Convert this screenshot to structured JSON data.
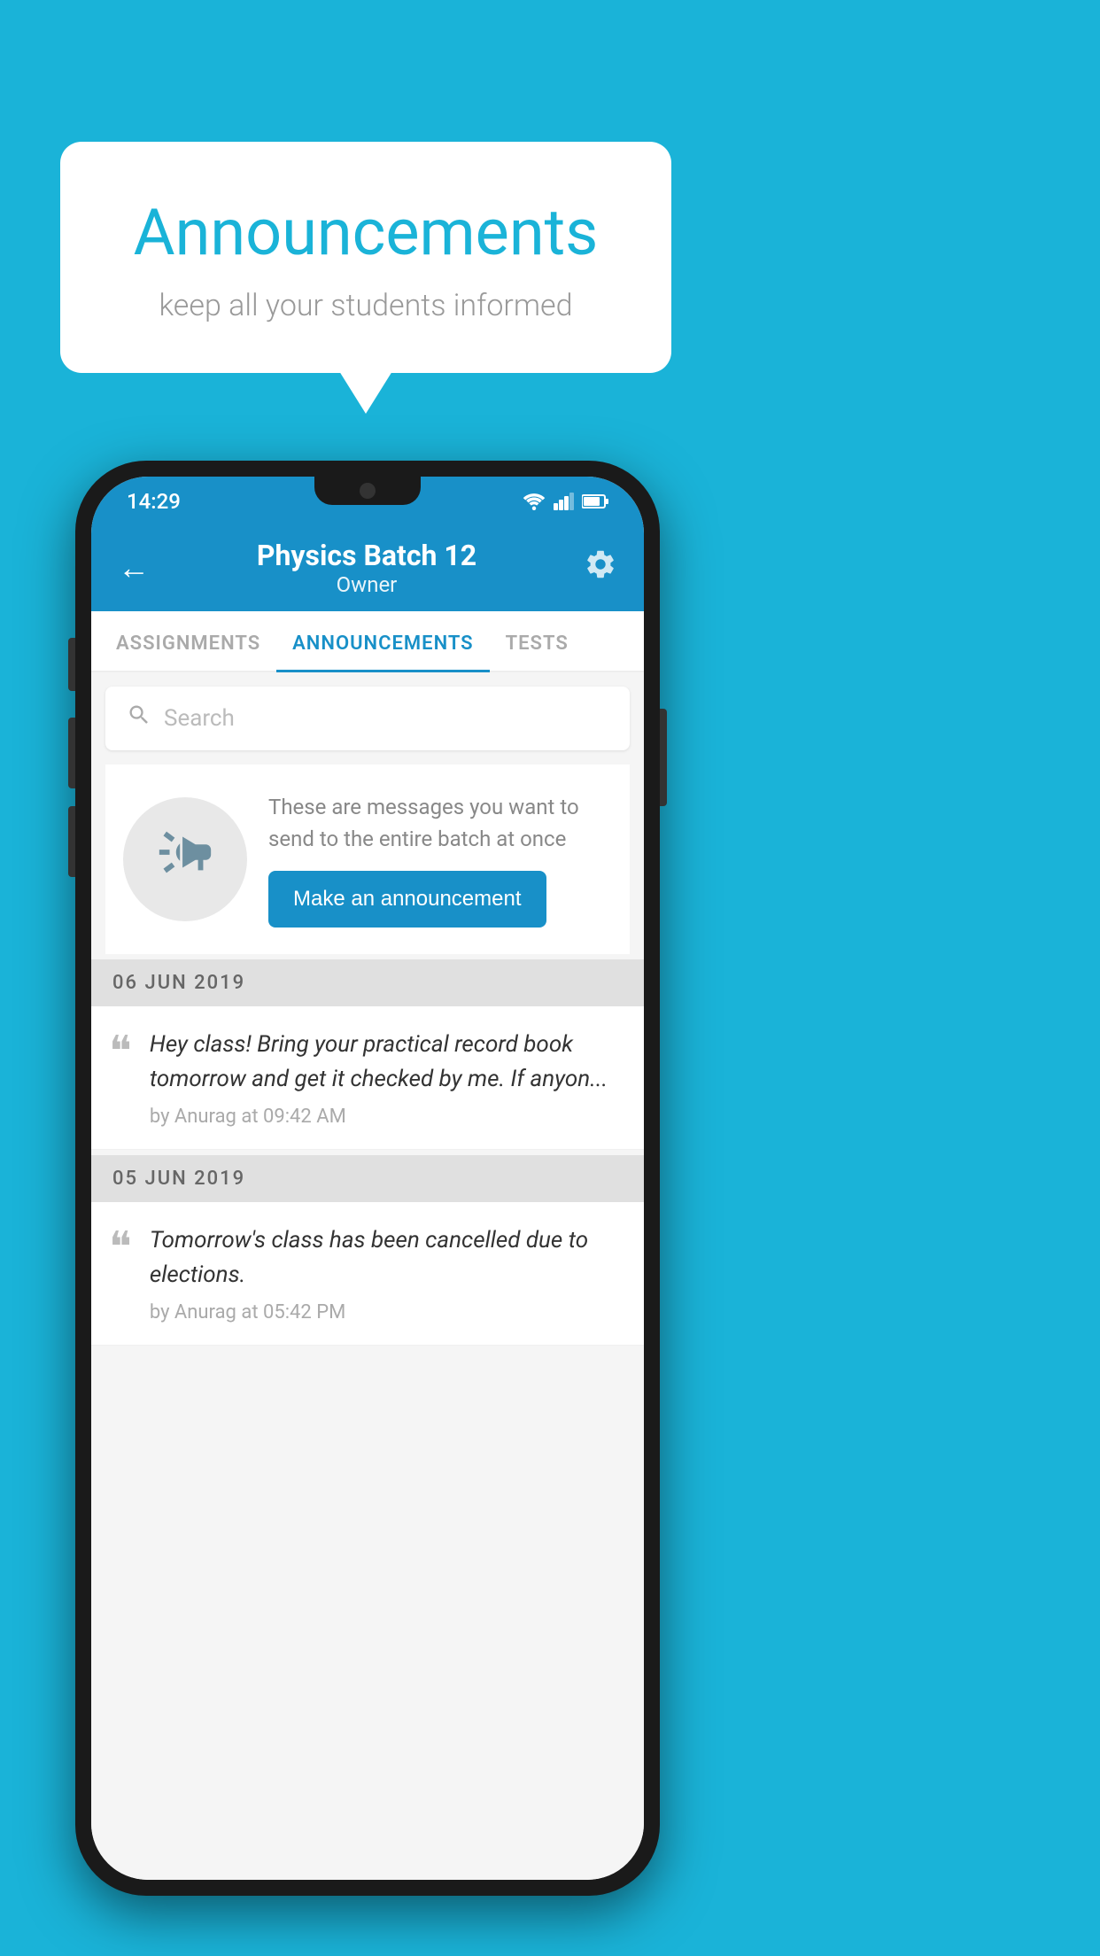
{
  "page": {
    "background_color": "#1ab3d8"
  },
  "speech_bubble": {
    "title": "Announcements",
    "subtitle": "keep all your students informed",
    "title_color": "#1ab3d8"
  },
  "phone": {
    "status_bar": {
      "time": "14:29"
    },
    "header": {
      "title": "Physics Batch 12",
      "subtitle": "Owner",
      "back_label": "←",
      "gear_label": "⚙"
    },
    "tabs": [
      {
        "label": "ASSIGNMENTS",
        "active": false
      },
      {
        "label": "ANNOUNCEMENTS",
        "active": true
      },
      {
        "label": "TESTS",
        "active": false
      }
    ],
    "search": {
      "placeholder": "Search"
    },
    "announcement_prompt": {
      "description": "These are messages you want to send to the entire batch at once",
      "button_label": "Make an announcement"
    },
    "announcements": [
      {
        "date": "06  JUN  2019",
        "text": "Hey class! Bring your practical record book tomorrow and get it checked by me. If anyon...",
        "meta": "by Anurag at 09:42 AM"
      },
      {
        "date": "05  JUN  2019",
        "text": "Tomorrow's class has been cancelled due to elections.",
        "meta": "by Anurag at 05:42 PM"
      }
    ]
  }
}
